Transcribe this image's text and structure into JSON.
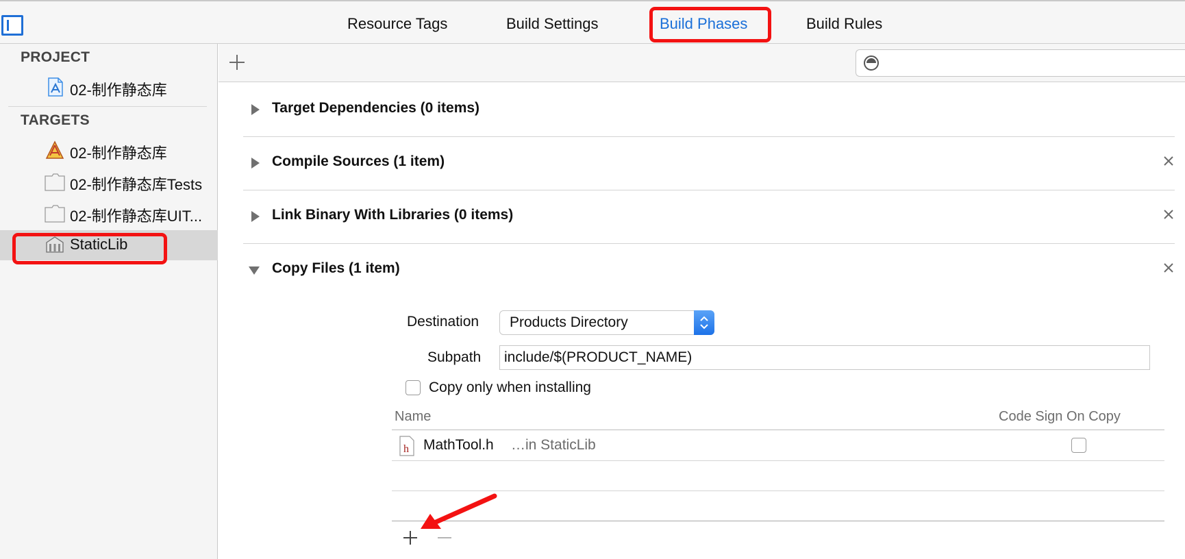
{
  "tabs": {
    "resource_tags": "Resource Tags",
    "build_settings": "Build Settings",
    "build_phases": "Build Phases",
    "build_rules": "Build Rules"
  },
  "sidebar": {
    "project_header": "PROJECT",
    "project_item": "02-制作静态库",
    "targets_header": "TARGETS",
    "targets": [
      {
        "label": "02-制作静态库",
        "icon": "app-target-icon"
      },
      {
        "label": "02-制作静态库Tests",
        "icon": "test-bundle-icon"
      },
      {
        "label": "02-制作静态库UIT...",
        "icon": "ui-test-bundle-icon"
      },
      {
        "label": "StaticLib",
        "icon": "static-library-icon",
        "selected": true
      }
    ]
  },
  "phases": [
    {
      "title": "Target Dependencies (0 items)",
      "expanded": false,
      "removable": false
    },
    {
      "title": "Compile Sources (1 item)",
      "expanded": false,
      "removable": true
    },
    {
      "title": "Link Binary With Libraries (0 items)",
      "expanded": false,
      "removable": true
    },
    {
      "title": "Copy Files (1 item)",
      "expanded": true,
      "removable": true
    }
  ],
  "copy_files": {
    "destination_label": "Destination",
    "destination_value": "Products Directory",
    "subpath_label": "Subpath",
    "subpath_value": "include/$(PRODUCT_NAME)",
    "copy_only_label": "Copy only when installing",
    "copy_only_checked": false,
    "columns": {
      "name": "Name",
      "code_sign": "Code Sign On Copy"
    },
    "files": [
      {
        "name": "MathTool.h",
        "location": "…in StaticLib",
        "code_sign": false
      }
    ]
  },
  "colors": {
    "accent": "#1a6fd8",
    "highlight_box": "#f31212",
    "annotation_arrow": "#f31212"
  }
}
